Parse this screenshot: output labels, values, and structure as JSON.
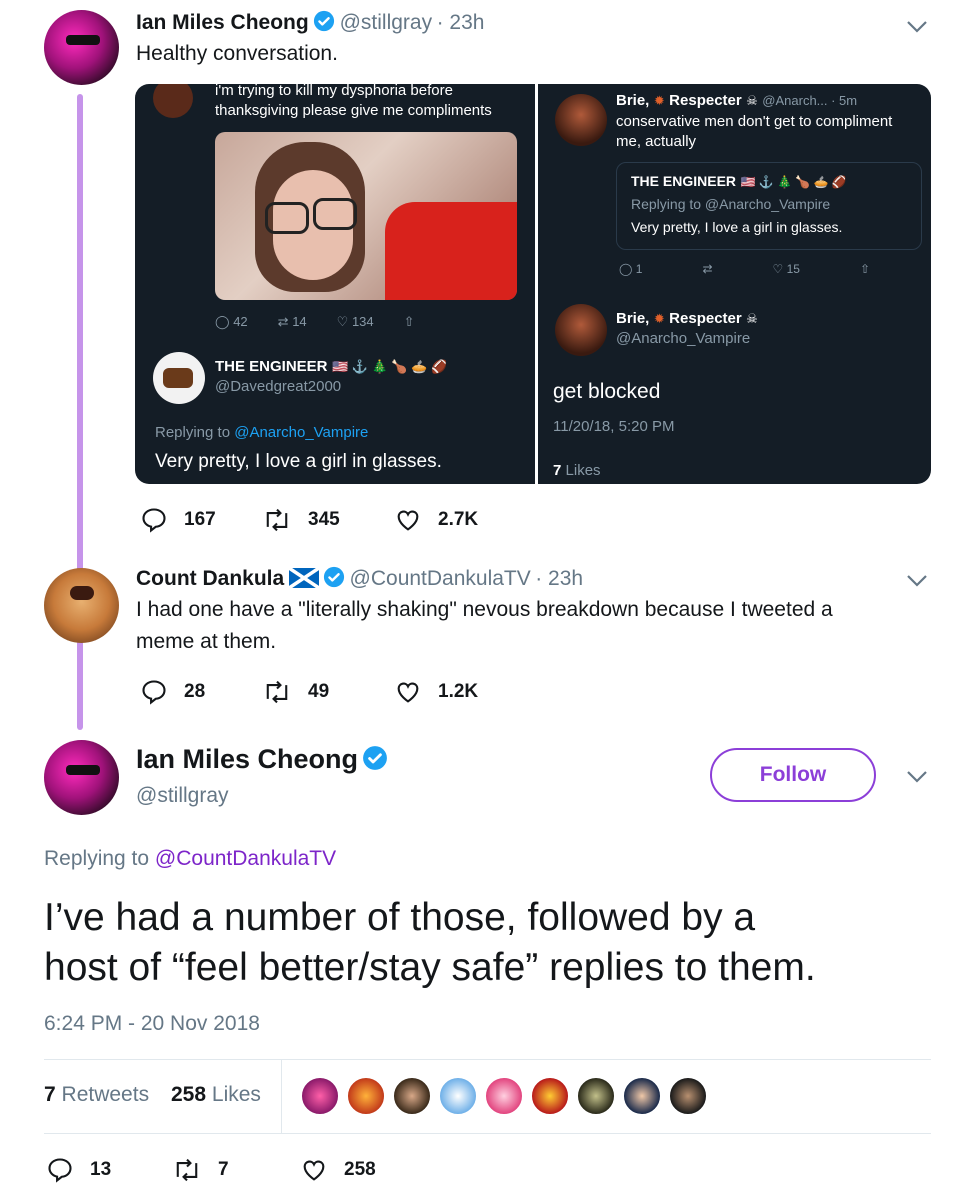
{
  "tweet1": {
    "name": "Ian Miles Cheong",
    "handle": "@stillgray",
    "time": "· 23h",
    "text": "Healthy conversation.",
    "replies": "167",
    "retweets": "345",
    "likes": "2.7K"
  },
  "embed_left": {
    "top_text_1": "i'm trying to kill my dysphoria before",
    "top_text_2": "thanksgiving please give me compliments",
    "replies": "42",
    "retweets": "14",
    "likes": "134",
    "reply_name": "THE ENGINEER",
    "reply_emoji": "🇺🇸 ⚓ 🎄 🍗 🥧 🏈",
    "reply_handle": "@Davedgreat2000",
    "replying_prefix": "Replying to",
    "replying_handle": "@Anarcho_Vampire",
    "reply_text": "Very pretty, I love a girl in glasses."
  },
  "embed_right": {
    "name": "Brie,",
    "name2": "Respecter",
    "handle_time": "@Anarch... · 5m",
    "text_1": "conservative men don't get to compliment",
    "text_2": "me, actually",
    "quote_name": "THE ENGINEER",
    "quote_emoji": "🇺🇸 ⚓ 🎄 🍗 🥧 🏈",
    "quote_replying": "Replying to @Anarcho_Vampire",
    "quote_text": "Very pretty, I love a girl in glasses.",
    "q_replies": "1",
    "q_likes": "15",
    "name_b": "Brie,",
    "name_b2": "Respecter",
    "handle_b": "@Anarcho_Vampire",
    "blocked_text": "get blocked",
    "timestamp": "11/20/18, 5:20 PM",
    "likes_count": "7",
    "likes_label": "Likes"
  },
  "tweet2": {
    "name": "Count Dankula",
    "handle": "@CountDankulaTV",
    "time": "· 23h",
    "text_1": "I had one have a \"literally shaking\" nevous breakdown because I tweeted a",
    "text_2": "meme at them.",
    "replies": "28",
    "retweets": "49",
    "likes": "1.2K"
  },
  "main_tweet": {
    "name": "Ian Miles Cheong",
    "handle": "@stillgray",
    "follow_label": "Follow",
    "replying_prefix": "Replying to",
    "replying_handle": "@CountDankulaTV",
    "text_1": "I’ve had a number of those, followed by a",
    "text_2": "host of “feel better/stay safe” replies to them.",
    "timestamp": "6:24 PM - 20 Nov 2018",
    "retweet_count": "7",
    "retweet_label": "Retweets",
    "like_count": "258",
    "like_label": "Likes",
    "replies": "13",
    "retweets": "7",
    "likes": "258"
  },
  "colors": {
    "accent": "#8c3fd8",
    "thread_line": "#c694ea",
    "verified": "#1da1f2",
    "dark_bg": "#141d26"
  }
}
